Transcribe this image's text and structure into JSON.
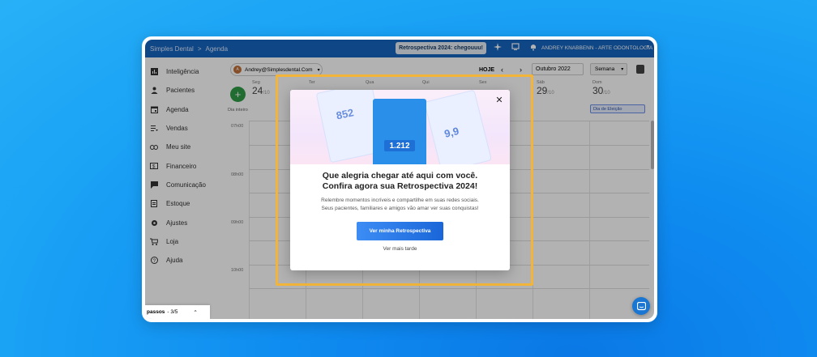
{
  "header": {
    "app_name": "Simples Dental",
    "separator": ">",
    "section": "Agenda",
    "promo_button": "Retrospectiva 2024: chegouuu!",
    "user_name": "ANDREY KNABBENN - ARTE ODONTOLOGIA"
  },
  "sidebar": {
    "items": [
      {
        "label": "Inteligência",
        "icon": "bar-chart-icon"
      },
      {
        "label": "Pacientes",
        "icon": "person-icon"
      },
      {
        "label": "Agenda",
        "icon": "calendar-icon"
      },
      {
        "label": "Vendas",
        "icon": "sales-list-icon"
      },
      {
        "label": "Meu site",
        "icon": "link-icon"
      },
      {
        "label": "Financeiro",
        "icon": "money-icon"
      },
      {
        "label": "Comunicação",
        "icon": "chat-icon"
      },
      {
        "label": "Estoque",
        "icon": "inventory-icon"
      },
      {
        "label": "Ajustes",
        "icon": "gear-icon"
      },
      {
        "label": "Loja",
        "icon": "cart-icon"
      },
      {
        "label": "Ajuda",
        "icon": "help-icon"
      }
    ]
  },
  "calendar": {
    "account_email": "Andrey@Simplesdental.Com",
    "today_label": "HOJE",
    "month_label": "Outubro 2022",
    "view_label": "Semana",
    "all_day_label": "Dia inteiro",
    "days": [
      {
        "name": "Seg",
        "num": "24",
        "month": "/10"
      },
      {
        "name": "Ter",
        "num": "",
        "month": ""
      },
      {
        "name": "Qua",
        "num": "",
        "month": ""
      },
      {
        "name": "Qui",
        "num": "",
        "month": ""
      },
      {
        "name": "Sex",
        "num": "",
        "month": ""
      },
      {
        "name": "Sáb",
        "num": "29",
        "month": "/10"
      },
      {
        "name": "Dom",
        "num": "30",
        "month": "/10"
      }
    ],
    "event_label": "Dia de Eleição",
    "times": [
      "07h00",
      "08h00",
      "09h00",
      "10h00"
    ],
    "checklist_label": "passos",
    "checklist_progress": "- 3/5"
  },
  "modal": {
    "title_line1": "Que alegria chegar até aqui com você.",
    "title_line2": "Confira agora sua Retrospectiva 2024!",
    "desc_line1": "Relembre momentos incríveis e compartilhe em suas redes sociais.",
    "desc_line2": "Seus pacientes, familiares e amigos vão amar ver suas conquistas!",
    "cta_label": "Ver minha Retrospectiva",
    "later_label": "Ver mais tarde",
    "hero": {
      "left_value": "852",
      "center_value": "1.212",
      "right_value": "9,9"
    }
  },
  "colors": {
    "topbar": "#1565c0",
    "highlight": "#f2b53a",
    "cta": "#1a66d9",
    "add_button": "#2e9b47"
  }
}
